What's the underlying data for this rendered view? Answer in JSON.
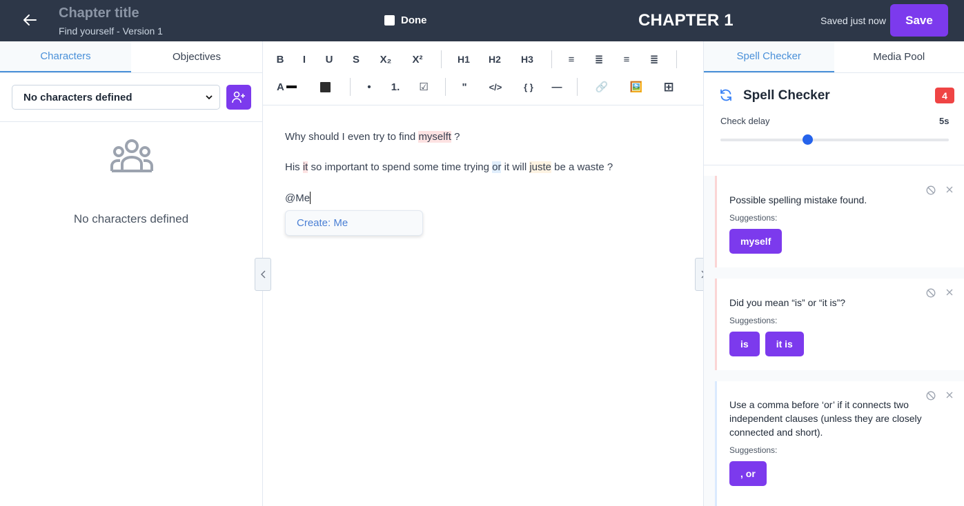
{
  "header": {
    "chapter_title": "Chapter title",
    "chapter_subtitle": "Find yourself - Version 1",
    "done_label": "Done",
    "chapter_number": "CHAPTER 1",
    "saved_status": "Saved just now",
    "save_label": "Save"
  },
  "left_panel": {
    "tabs": [
      {
        "label": "Characters",
        "active": true
      },
      {
        "label": "Objectives",
        "active": false
      }
    ],
    "select_value": "No characters defined",
    "empty_message": "No characters defined"
  },
  "toolbar": {
    "row1": [
      "B",
      "I",
      "U",
      "S",
      "X₂",
      "X²",
      "H1",
      "H2",
      "H3",
      "≡",
      "≣",
      "≡",
      "≣"
    ],
    "row2": [
      "A",
      "⬛",
      "•",
      "1.",
      "☑",
      "\"",
      "</>",
      "{ }",
      "—",
      "🔗",
      "🖼️",
      "⊞"
    ]
  },
  "editor": {
    "p1_before": "Why should I even try to find ",
    "p1_error": "myselft",
    "p1_after": " ?",
    "p2_a": "His ",
    "p2_err1": "it",
    "p2_b": " so important to spend some time trying ",
    "p2_err2": "or",
    "p2_c": " it will ",
    "p2_err3": "juste",
    "p2_d": " be a waste ?",
    "p3": "@Me",
    "mention_option": "Create: Me"
  },
  "right_panel": {
    "tabs": [
      {
        "label": "Spell Checker",
        "active": true
      },
      {
        "label": "Media Pool",
        "active": false
      }
    ],
    "title": "Spell Checker",
    "issue_count": "4",
    "delay_label": "Check delay",
    "delay_value": "5s",
    "delay_fraction": 0.38,
    "suggestions_label": "Suggestions:",
    "cards": [
      {
        "message": "Possible spelling mistake found.",
        "suggestions": [
          "myself"
        ]
      },
      {
        "message": "Did you mean “is” or “it is”?",
        "suggestions": [
          "is",
          "it is"
        ]
      },
      {
        "message": "Use a comma before ‘or’ if it connects two independent clauses (unless they are closely connected and short).",
        "suggestions": [
          ", or"
        ]
      }
    ]
  },
  "colors": {
    "header_bg": "#2d3748",
    "accent_purple": "#7c3aed",
    "tab_active": "#4a90d9",
    "badge_red": "#ef4444"
  }
}
